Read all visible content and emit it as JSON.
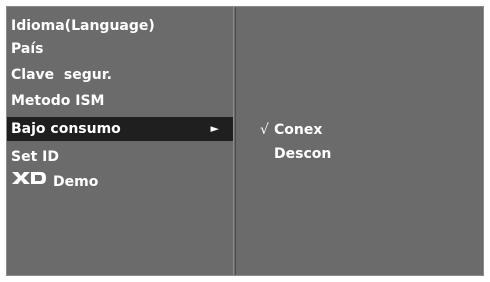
{
  "menu": {
    "items": [
      {
        "label": "Idioma(Language)"
      },
      {
        "label": "País"
      },
      {
        "label": "Clave  segur."
      },
      {
        "label": "Metodo ISM"
      },
      {
        "label": "Bajo consumo",
        "arrow": "►"
      },
      {
        "label": "Set ID"
      },
      {
        "label": "Demo",
        "logo": "XD"
      }
    ]
  },
  "submenu": {
    "check_mark": "√",
    "options": [
      {
        "label": "Conex",
        "selected": true
      },
      {
        "label": "Descon",
        "selected": false
      }
    ]
  },
  "colors": {
    "panel_background": "#6b6b6b",
    "selected_row": "#1f1f1f",
    "text": "#ffffff"
  }
}
